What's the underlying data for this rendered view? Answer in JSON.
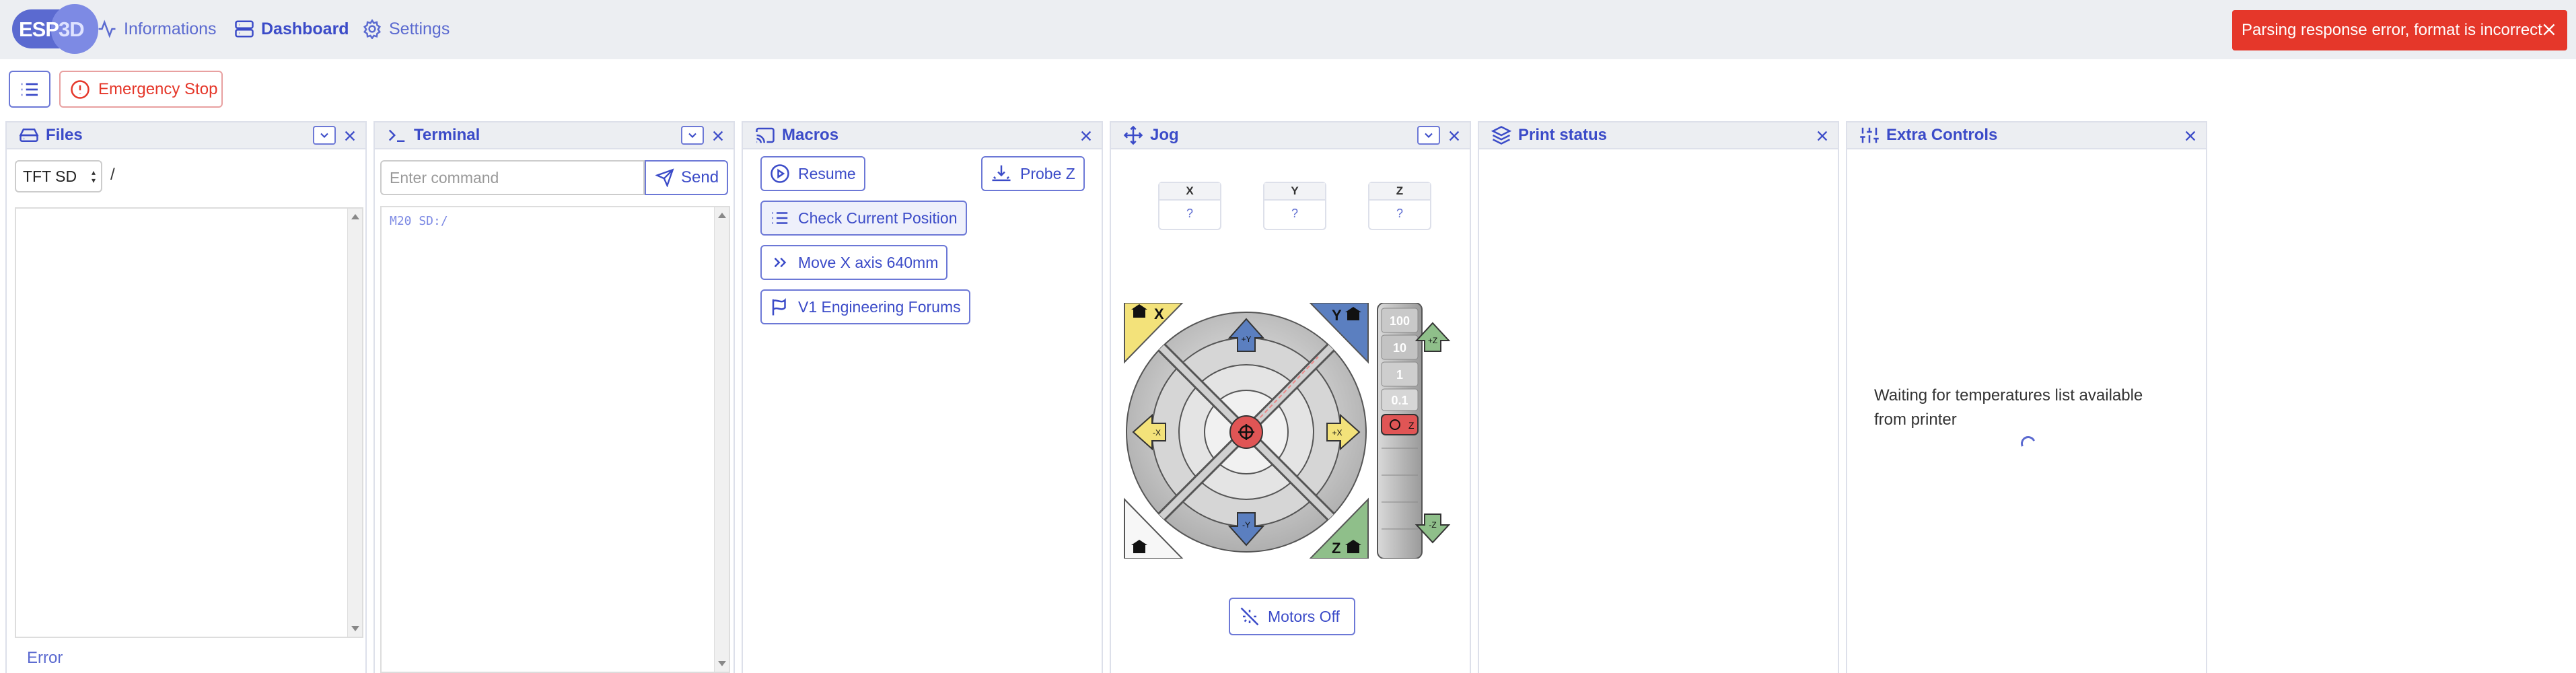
{
  "app": {
    "logo": {
      "esp": "ESP",
      "d3": "3D"
    },
    "nav": [
      {
        "label": "Informations",
        "icon": "activity-icon",
        "active": false
      },
      {
        "label": "Dashboard",
        "icon": "server-icon",
        "active": true
      },
      {
        "label": "Settings",
        "icon": "gear-icon",
        "active": false
      }
    ]
  },
  "toast": {
    "message": "Parsing response error, format is incorrect",
    "color": "#e5372a"
  },
  "toolbar": {
    "emergency_label": "Emergency Stop"
  },
  "panels": {
    "files": {
      "title": "Files",
      "source_select": "TFT SD",
      "path": "/",
      "error_link": "Error"
    },
    "terminal": {
      "title": "Terminal",
      "placeholder": "Enter command",
      "send_label": "Send",
      "output": "M20 SD:/"
    },
    "macros": {
      "title": "Macros",
      "buttons": [
        {
          "label": "Resume",
          "icon": "play-circle-icon"
        },
        {
          "label": "Probe Z",
          "icon": "probe-icon"
        },
        {
          "label": "Check Current Position",
          "icon": "list-icon"
        },
        {
          "label": "Move X axis 640mm",
          "icon": "chevrons-right-icon"
        },
        {
          "label": "V1 Engineering Forums",
          "icon": "flag-icon"
        }
      ]
    },
    "jog": {
      "title": "Jog",
      "positions": [
        {
          "axis": "X",
          "value": "?"
        },
        {
          "axis": "Y",
          "value": "?"
        },
        {
          "axis": "Z",
          "value": "?"
        }
      ],
      "z_steps": [
        "100",
        "10",
        "1",
        "0.1"
      ],
      "xy_labels": {
        "home_x": "X",
        "home_y": "Y",
        "home_z": "Z",
        "plus_y": "+Y",
        "minus_y": "-Y",
        "plus_x": "+X",
        "minus_x": "-X",
        "plus_z": "+Z",
        "minus_z": "-Z",
        "center": "XY",
        "center_z": "Z"
      },
      "motors_off_label": "Motors Off"
    },
    "print_status": {
      "title": "Print status"
    },
    "extra_controls": {
      "title": "Extra Controls",
      "waiting_text": "Waiting for temperatures list available from printer"
    }
  },
  "colors": {
    "accent": "#3b4bc8",
    "danger": "#e5372a",
    "home_x": "#f3e27a",
    "home_y": "#5b7fc0",
    "home_z": "#8fbf8a"
  }
}
